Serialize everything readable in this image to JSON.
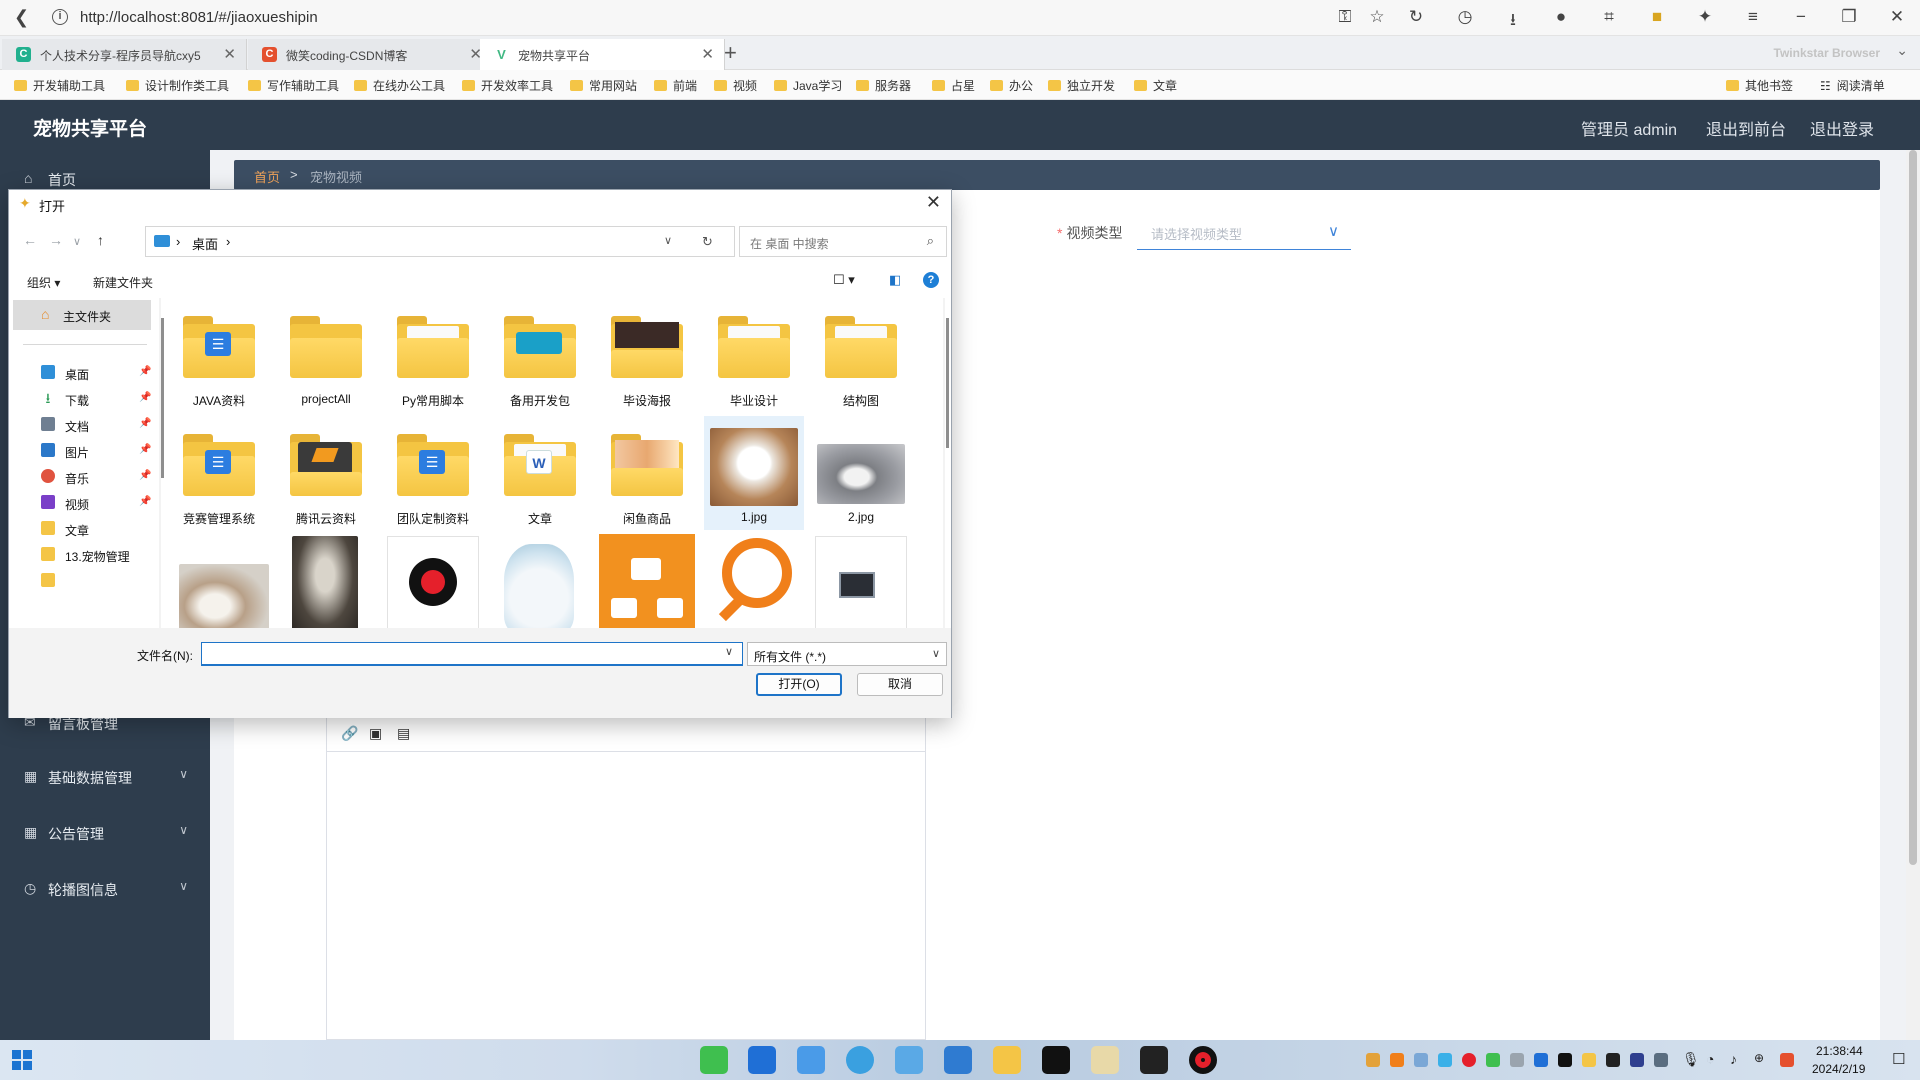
{
  "browser": {
    "url": "http://localhost:8081/#/jiaoxueshipin",
    "tabs": [
      {
        "title": "个人技术分享-程序员导航cxy5",
        "favicon": "C",
        "color": "#21b08e"
      },
      {
        "title": "微笑coding-CSDN博客",
        "favicon": "C",
        "color": "#e4502e"
      },
      {
        "title": "宠物共享平台",
        "favicon": "V",
        "color": "#41b883"
      }
    ],
    "brand": "Twinkstar Browser",
    "bookmarks": [
      "开发辅助工具",
      "设计制作类工具",
      "写作辅助工具",
      "在线办公工具",
      "开发效率工具",
      "常用网站",
      "前端",
      "视频",
      "Java学习",
      "服务器",
      "占星",
      "办公",
      "独立开发",
      "文章"
    ],
    "bookmarks_right": [
      "其他书签",
      "阅读清单"
    ]
  },
  "app": {
    "title": "宠物共享平台",
    "admin": "管理员 admin",
    "to_front": "退出到前台",
    "logout": "退出登录",
    "sidebar": [
      {
        "label": "首页",
        "icon": "home-icon"
      },
      {
        "label": "留言板管理",
        "icon": "message-icon"
      },
      {
        "label": "基础数据管理",
        "icon": "grid-icon"
      },
      {
        "label": "公告管理",
        "icon": "notice-icon"
      },
      {
        "label": "轮播图信息",
        "icon": "carousel-icon"
      }
    ],
    "breadcrumb": {
      "home": "首页",
      "sep": ">",
      "current": "宠物视频"
    },
    "form": {
      "video_type_label": "视频类型",
      "required_mark": "*",
      "video_type_placeholder": "请选择视频类型"
    }
  },
  "dialog": {
    "title": "打开",
    "address": {
      "root": "桌面"
    },
    "search_placeholder": "在 桌面 中搜索",
    "organize": "组织 ▾",
    "new_folder": "新建文件夹",
    "nav": {
      "home": "主文件夹",
      "items": [
        {
          "label": "桌面",
          "color": "#2f8fd8",
          "pinned": true
        },
        {
          "label": "下载",
          "color": "#2b9a56",
          "pinned": true
        },
        {
          "label": "文档",
          "color": "#6f7f92",
          "pinned": true
        },
        {
          "label": "图片",
          "color": "#2b78c9",
          "pinned": true
        },
        {
          "label": "音乐",
          "color": "#e0533f",
          "pinned": true
        },
        {
          "label": "视频",
          "color": "#7a3fc8",
          "pinned": true
        },
        {
          "label": "文章",
          "color": "#f4c546",
          "pinned": false
        },
        {
          "label": "13.宠物管理",
          "color": "#f4c546",
          "pinned": false
        },
        {
          "label": "",
          "color": "#f4c546",
          "pinned": false
        }
      ]
    },
    "files_row1": [
      {
        "name": "JAVA资料",
        "kind": "folder-badge",
        "badge_color": "#2c7de0"
      },
      {
        "name": "projectAll",
        "kind": "folder-plain"
      },
      {
        "name": "Py常用脚本",
        "kind": "folder-paper"
      },
      {
        "name": "备用开发包",
        "kind": "folder-badge",
        "badge_color": "#1aa0c8"
      },
      {
        "name": "毕设海报",
        "kind": "folder-dark"
      },
      {
        "name": "毕业设计",
        "kind": "folder-paper"
      },
      {
        "name": "结构图",
        "kind": "folder-paper"
      }
    ],
    "files_row2": [
      {
        "name": "竞赛管理系统",
        "kind": "folder-badge",
        "badge_color": "#2c7de0"
      },
      {
        "name": "腾讯云资料",
        "kind": "folder-dark-orange"
      },
      {
        "name": "团队定制资料",
        "kind": "folder-badge",
        "badge_color": "#2c7de0"
      },
      {
        "name": "文章",
        "kind": "folder-word"
      },
      {
        "name": "闲鱼商品",
        "kind": "folder-photo"
      },
      {
        "name": "1.jpg",
        "kind": "image-dog",
        "selected": true
      },
      {
        "name": "2.jpg",
        "kind": "image-cat"
      }
    ],
    "file_name_label": "文件名(N):",
    "file_name_value": "",
    "file_type": "所有文件 (*.*)",
    "open_button": "打开(O)",
    "cancel_button": "取消"
  },
  "taskbar": {
    "time": "21:38:44",
    "date": "2024/2/19"
  }
}
